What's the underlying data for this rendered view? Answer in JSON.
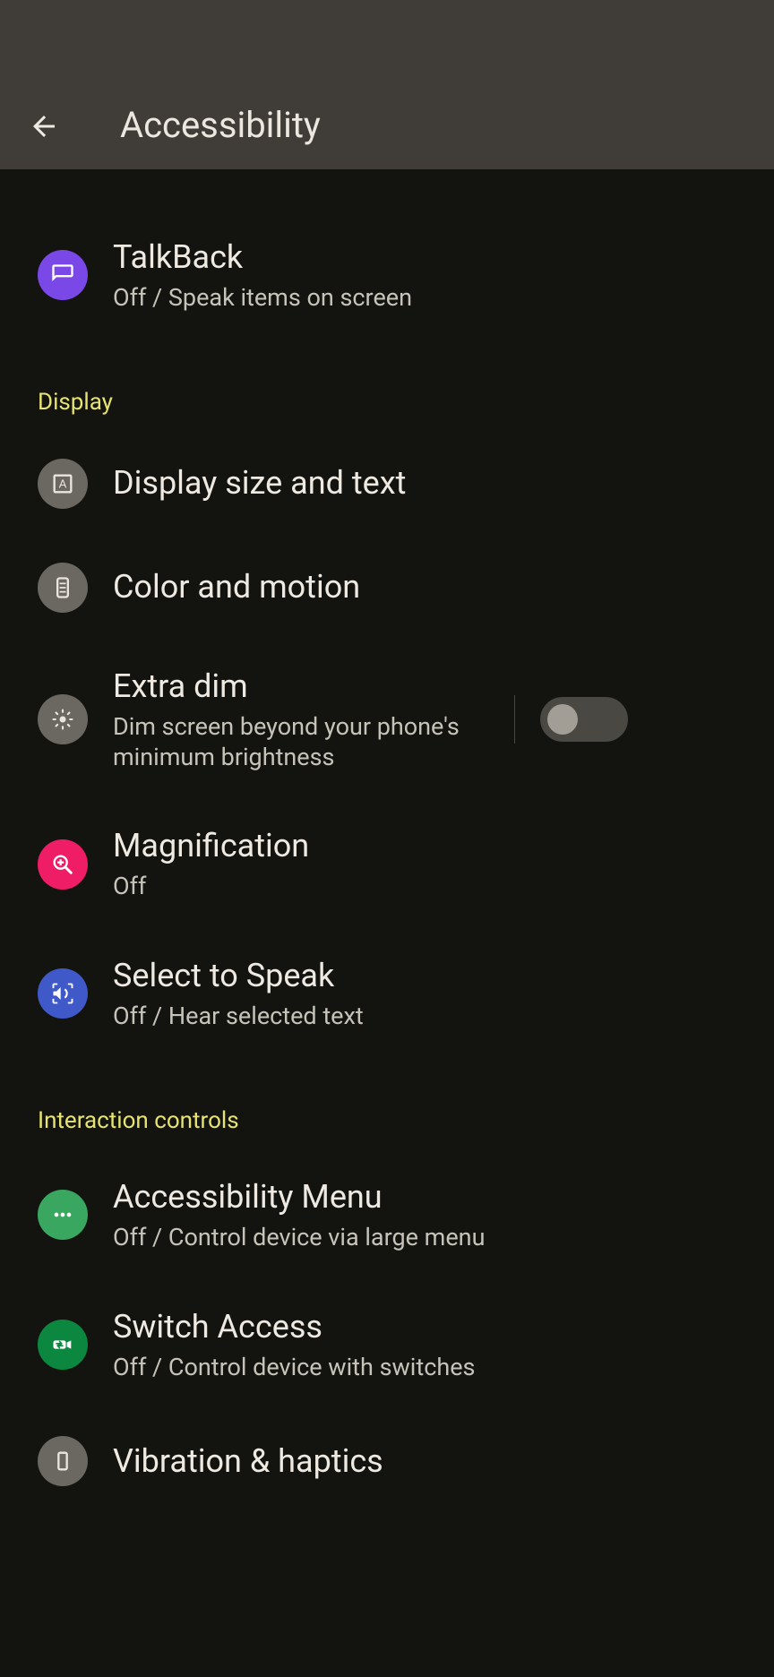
{
  "header": {
    "title": "Accessibility"
  },
  "items": {
    "talkback": {
      "title": "TalkBack",
      "subtitle": "Off / Speak items on screen"
    },
    "display_size": {
      "title": "Display size and text"
    },
    "color_motion": {
      "title": "Color and motion"
    },
    "extra_dim": {
      "title": "Extra dim",
      "subtitle": "Dim screen beyond your phone's minimum brightness",
      "toggle": "off"
    },
    "magnification": {
      "title": "Magnification",
      "subtitle": "Off"
    },
    "select_to_speak": {
      "title": "Select to Speak",
      "subtitle": "Off / Hear selected text"
    },
    "accessibility_menu": {
      "title": "Accessibility Menu",
      "subtitle": "Off / Control device via large menu"
    },
    "switch_access": {
      "title": "Switch Access",
      "subtitle": "Off / Control device with switches"
    },
    "vibration": {
      "title": "Vibration & haptics"
    }
  },
  "sections": {
    "display": "Display",
    "interaction": "Interaction controls"
  }
}
